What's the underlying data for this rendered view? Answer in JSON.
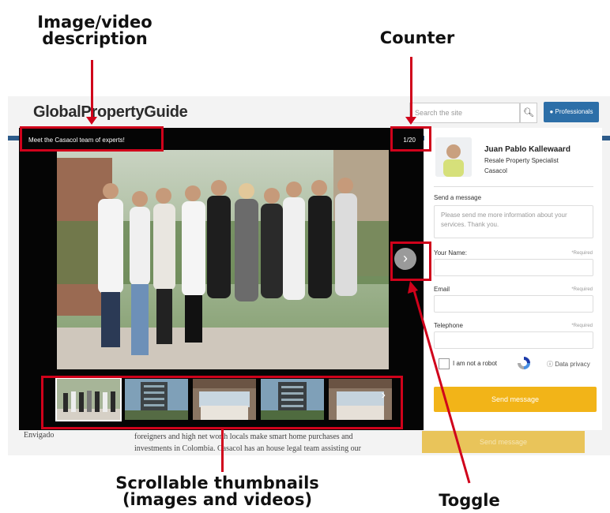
{
  "annotations": {
    "description_line1": "Image/video",
    "description_line2": "description",
    "counter": "Counter",
    "thumbnails_line1": "Scrollable thumbnails",
    "thumbnails_line2": "(images and videos)",
    "toggle": "Toggle",
    "color": "#d0021b"
  },
  "site": {
    "logo": "GlobalPropertyGuide",
    "search_placeholder": "Search the site",
    "professionals_label": "Professionals",
    "sidebar_item": "Envigado",
    "body_text_line1": "foreigners and high net worth locals make smart home purchases and",
    "body_text_line2": "investments in Colombia. Casacol has an house legal team assisting our",
    "bg_send_label": "Send message"
  },
  "lightbox": {
    "caption": "Meet the Casacol team of experts!",
    "counter": "1/20",
    "next_icon": "chevron-right-icon",
    "thumb_arrow_icon": "chevron-right-icon"
  },
  "contact": {
    "agent_name": "Juan Pablo Kallewaard",
    "agent_role": "Resale Property Specialist",
    "agent_company": "Casacol",
    "message_label": "Send a message",
    "message_placeholder": "Please send me more information about your services. Thank you.",
    "name_label": "Your Name:",
    "email_label": "Email",
    "telephone_label": "Telephone",
    "required": "*Required",
    "captcha_label": "I am not a robot",
    "privacy_label": "Data privacy",
    "send_label": "Send message",
    "accent_color": "#f2b418"
  }
}
